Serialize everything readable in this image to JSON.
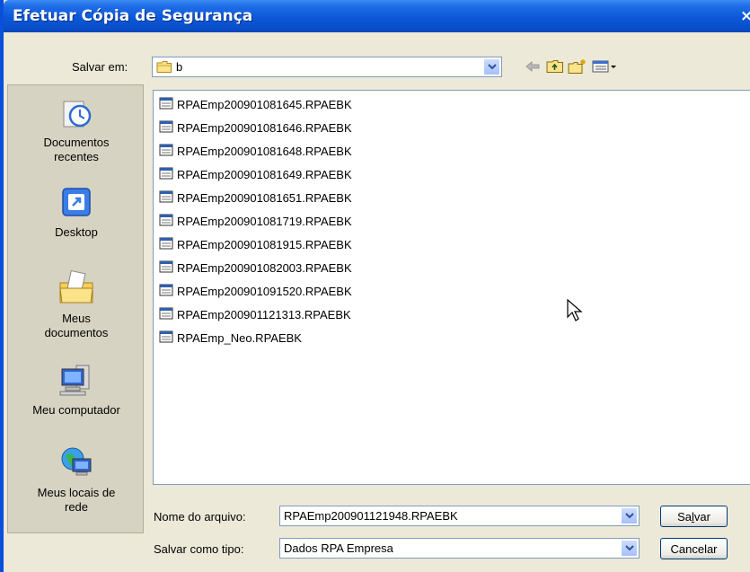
{
  "window": {
    "title": "Efetuar Cópia de Segurança",
    "close_glyph": "×"
  },
  "save_in": {
    "label": "Salvar em:",
    "value": "b"
  },
  "places": [
    {
      "label_line1": "Documentos",
      "label_line2": "recentes",
      "icon": "recent-documents-icon"
    },
    {
      "label_line1": "Desktop",
      "label_line2": "",
      "icon": "desktop-icon"
    },
    {
      "label_line1": "Meus",
      "label_line2": "documentos",
      "icon": "my-documents-icon"
    },
    {
      "label_line1": "Meu computador",
      "label_line2": "",
      "icon": "my-computer-icon"
    },
    {
      "label_line1": "Meus locais de",
      "label_line2": "rede",
      "icon": "network-places-icon"
    }
  ],
  "files": [
    "RPAEmp200901081645.RPAEBK",
    "RPAEmp200901081646.RPAEBK",
    "RPAEmp200901081648.RPAEBK",
    "RPAEmp200901081649.RPAEBK",
    "RPAEmp200901081651.RPAEBK",
    "RPAEmp200901081719.RPAEBK",
    "RPAEmp200901081915.RPAEBK",
    "RPAEmp200901082003.RPAEBK",
    "RPAEmp200901091520.RPAEBK",
    "RPAEmp200901121313.RPAEBK",
    "RPAEmp_Neo.RPAEBK"
  ],
  "filename": {
    "label": "Nome do arquivo:",
    "value": "RPAEmp200901121948.RPAEBK"
  },
  "filetype": {
    "label": "Salvar como tipo:",
    "value": "Dados RPA Empresa"
  },
  "buttons": {
    "save_pre": "Sa",
    "save_ul": "l",
    "save_post": "var",
    "cancel": "Cancelar"
  },
  "colors": {
    "title_bar": "#0a4fcc",
    "dialog_bg": "#ece9d8",
    "places_bg": "#d7d3c2"
  }
}
